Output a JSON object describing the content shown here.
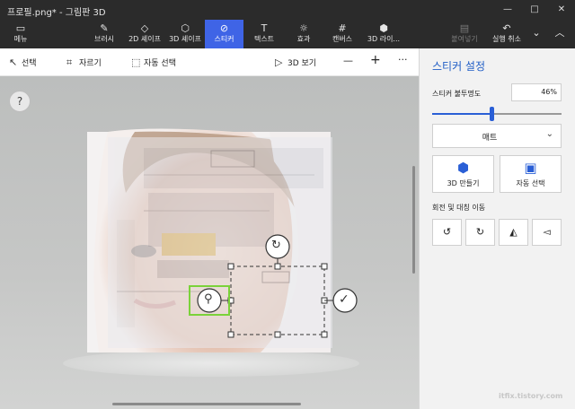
{
  "window": {
    "title": "프로필.png* - 그림판 3D",
    "controls": {
      "minimize": "—",
      "maximize": "□",
      "close": "✕"
    }
  },
  "ribbon": {
    "menu": "메뉴",
    "tools": [
      {
        "label": "브러시",
        "icon": "brush-icon"
      },
      {
        "label": "2D 셰이프",
        "icon": "2d-shapes-icon"
      },
      {
        "label": "3D 셰이프",
        "icon": "3d-shapes-icon"
      },
      {
        "label": "스티커",
        "icon": "stickers-icon",
        "active": true
      },
      {
        "label": "텍스트",
        "icon": "text-icon"
      },
      {
        "label": "효과",
        "icon": "effects-icon"
      },
      {
        "label": "캔버스",
        "icon": "canvas-icon"
      },
      {
        "label": "3D 라이...",
        "icon": "3d-library-icon"
      }
    ],
    "paste": "붙여넣기",
    "undo": "실행 취소",
    "more": "⌄",
    "expand": "︿"
  },
  "toolbar": {
    "select": "선택",
    "crop": "자르기",
    "magic_select": "자동 선택",
    "view_3d": "3D 보기",
    "zoom_out": "—",
    "zoom_in": "+",
    "more": "···"
  },
  "canvas": {
    "help": "?",
    "stamp_glyph": "⚲",
    "rotate_glyph": "↻",
    "confirm_glyph": "✓"
  },
  "panel": {
    "title": "스티커 설정",
    "opacity_label": "스티커 불투명도",
    "opacity_value": "46%",
    "opacity_fraction": 0.46,
    "finish": {
      "selected": "매트",
      "chevron": "⌄"
    },
    "make_3d": "3D 만들기",
    "magic_select": "자동 선택",
    "rotate_flip_label": "회전 및 대칭 이동",
    "rotate_buttons": [
      {
        "name": "rotate-left-button",
        "glyph": "↺"
      },
      {
        "name": "rotate-right-button",
        "glyph": "↻"
      },
      {
        "name": "flip-horizontal-button",
        "glyph": "◭"
      },
      {
        "name": "flip-vertical-button",
        "glyph": "◅"
      }
    ]
  },
  "watermark": "itfix.tistory.com",
  "colors": {
    "accent": "#3f64e6",
    "panel_title": "#1f5dc6",
    "dark_chrome": "#2b2b2b",
    "stamp_border": "#7bd23a"
  }
}
